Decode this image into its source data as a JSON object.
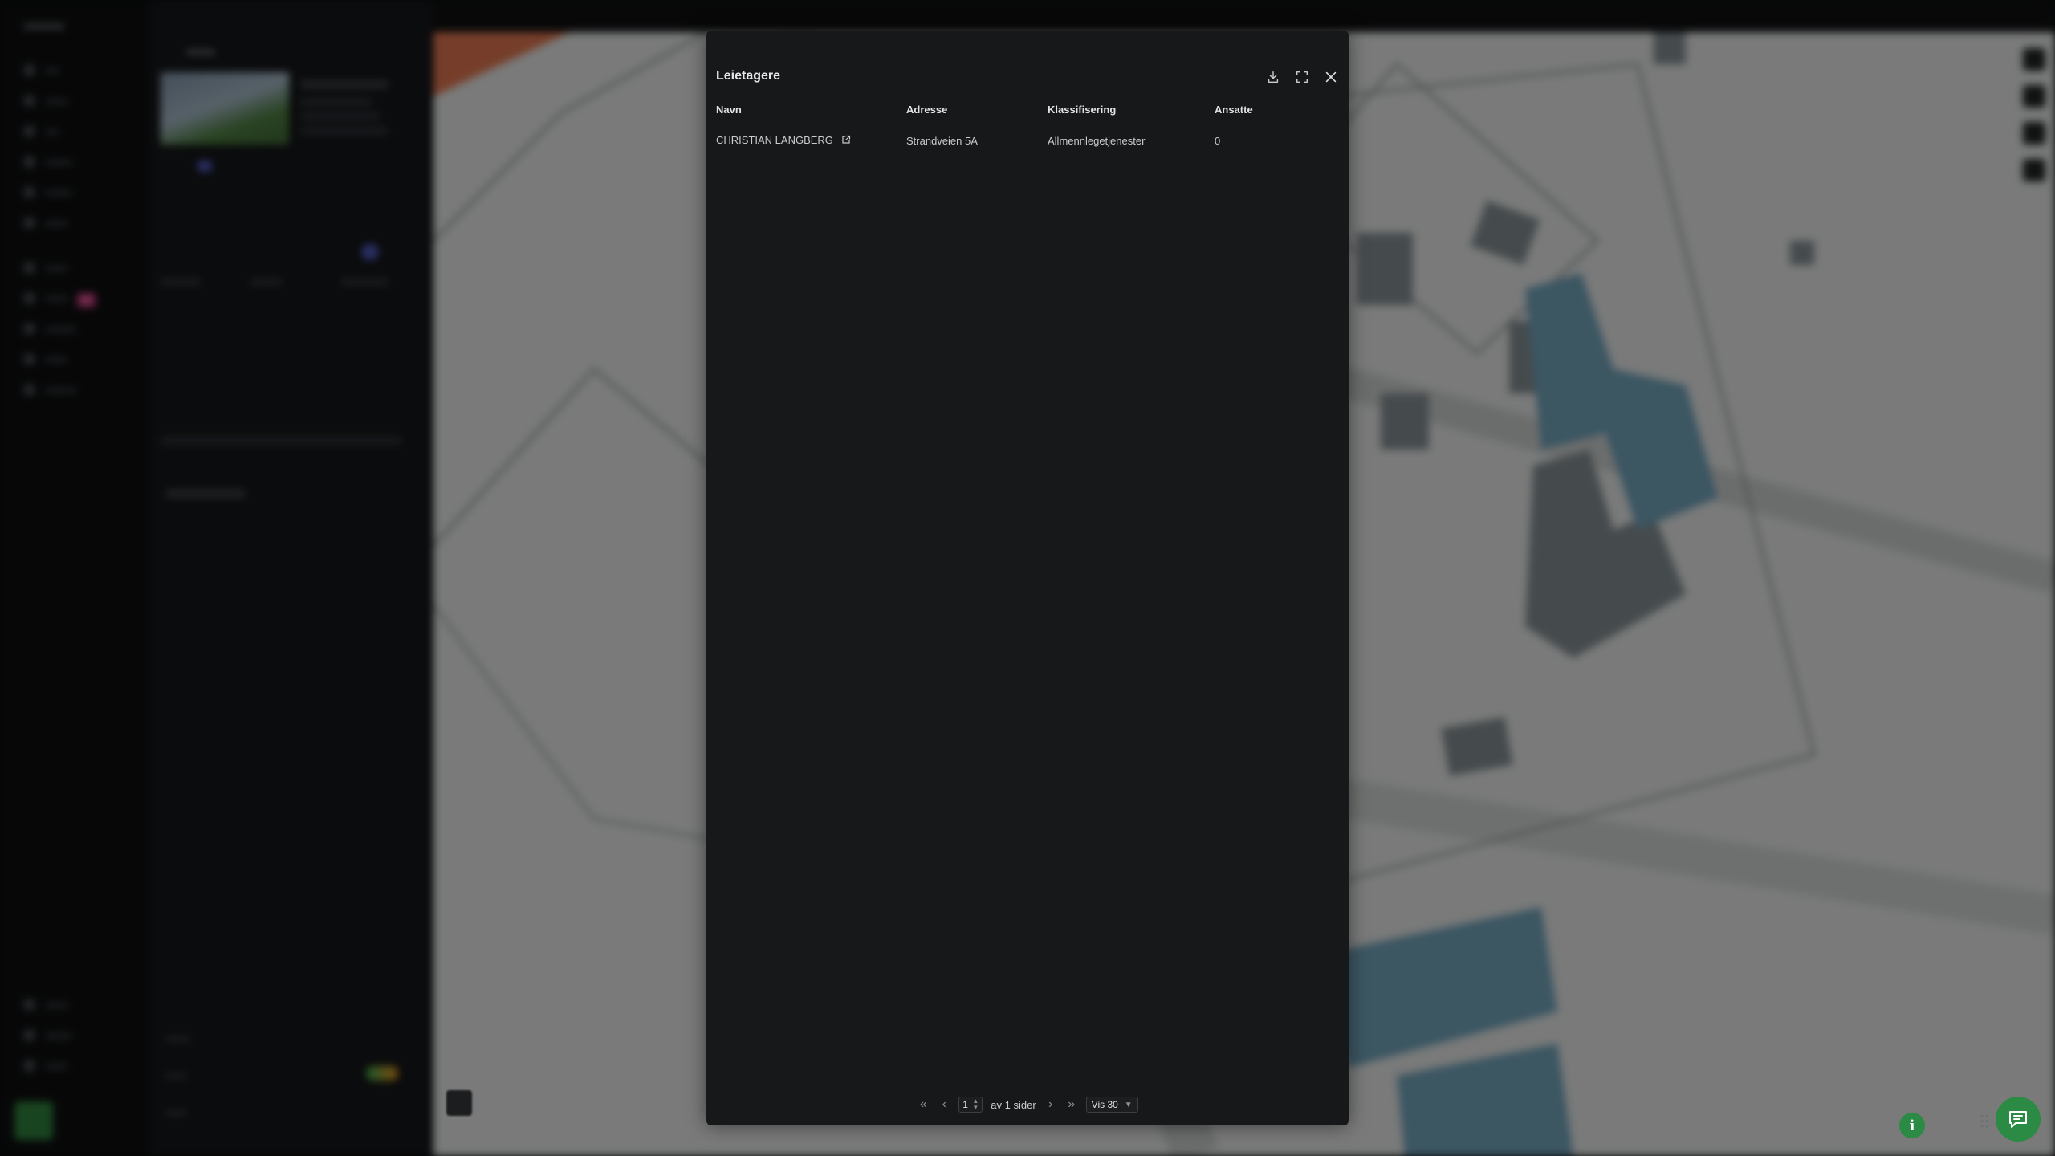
{
  "modal": {
    "title": "Leietagere",
    "columns": [
      "Navn",
      "Adresse",
      "Klassifisering",
      "Ansatte"
    ],
    "rows": [
      {
        "navn": "CHRISTIAN LANGBERG",
        "adresse": "Strandveien 5A",
        "klassifisering": "Allmennlegetjenester",
        "ansatte": "0"
      }
    ]
  },
  "pagination": {
    "current_page": "1",
    "of_pages_text": "av 1 sider",
    "page_size_label": "Vis 30"
  },
  "icons": {
    "download": "download-icon",
    "fullscreen": "fullscreen-icon",
    "close": "close-icon",
    "external_link": "external-link-icon",
    "first_page": "first-page-icon",
    "prev_page": "prev-page-icon",
    "next_page": "next-page-icon",
    "last_page": "last-page-icon",
    "chat": "chat-icon",
    "info": "info-icon"
  },
  "colors": {
    "modal_bg": "#161819",
    "accent_green": "#2b8a43",
    "map_bg": "#dcdedd",
    "building_blue": "#6d9db3"
  }
}
